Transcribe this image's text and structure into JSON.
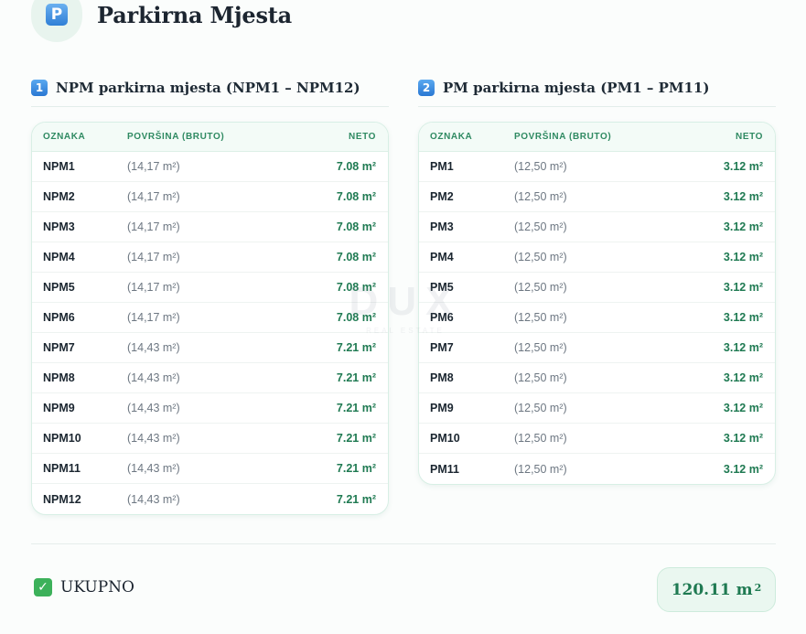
{
  "header": {
    "icon": "parking-p-icon",
    "title": "Parkirna Mjesta"
  },
  "sections": [
    {
      "badge": "1",
      "title": "NPM parkirna mjesta (NPM1 – NPM12)",
      "columns": [
        "OZNAKA",
        "POVRŠINA (BRUTO)",
        "NETO"
      ],
      "rows": [
        [
          "NPM1",
          "(14,17 m²)",
          "7.08 m²"
        ],
        [
          "NPM2",
          "(14,17 m²)",
          "7.08 m²"
        ],
        [
          "NPM3",
          "(14,17 m²)",
          "7.08 m²"
        ],
        [
          "NPM4",
          "(14,17 m²)",
          "7.08 m²"
        ],
        [
          "NPM5",
          "(14,17 m²)",
          "7.08 m²"
        ],
        [
          "NPM6",
          "(14,17 m²)",
          "7.08 m²"
        ],
        [
          "NPM7",
          "(14,43 m²)",
          "7.21 m²"
        ],
        [
          "NPM8",
          "(14,43 m²)",
          "7.21 m²"
        ],
        [
          "NPM9",
          "(14,43 m²)",
          "7.21 m²"
        ],
        [
          "NPM10",
          "(14,43 m²)",
          "7.21 m²"
        ],
        [
          "NPM11",
          "(14,43 m²)",
          "7.21 m²"
        ],
        [
          "NPM12",
          "(14,43 m²)",
          "7.21 m²"
        ]
      ]
    },
    {
      "badge": "2",
      "title": "PM parkirna mjesta (PM1 – PM11)",
      "columns": [
        "OZNAKA",
        "POVRŠINA (BRUTO)",
        "NETO"
      ],
      "rows": [
        [
          "PM1",
          "(12,50 m²)",
          "3.12 m²"
        ],
        [
          "PM2",
          "(12,50 m²)",
          "3.12 m²"
        ],
        [
          "PM3",
          "(12,50 m²)",
          "3.12 m²"
        ],
        [
          "PM4",
          "(12,50 m²)",
          "3.12 m²"
        ],
        [
          "PM5",
          "(12,50 m²)",
          "3.12 m²"
        ],
        [
          "PM6",
          "(12,50 m²)",
          "3.12 m²"
        ],
        [
          "PM7",
          "(12,50 m²)",
          "3.12 m²"
        ],
        [
          "PM8",
          "(12,50 m²)",
          "3.12 m²"
        ],
        [
          "PM9",
          "(12,50 m²)",
          "3.12 m²"
        ],
        [
          "PM10",
          "(12,50 m²)",
          "3.12 m²"
        ],
        [
          "PM11",
          "(12,50 m²)",
          "3.12 m²"
        ]
      ]
    }
  ],
  "watermark": {
    "main": "DUX",
    "sub": "REAL ESTATE"
  },
  "total": {
    "icon": "check-mark-icon",
    "label": "UKUPNO",
    "value": "120.11 m",
    "unit_sup": "2"
  },
  "colors": {
    "accent": "#1f7a52",
    "header_text": "#2f8a62",
    "badge_blue": "#2f7fd6"
  }
}
